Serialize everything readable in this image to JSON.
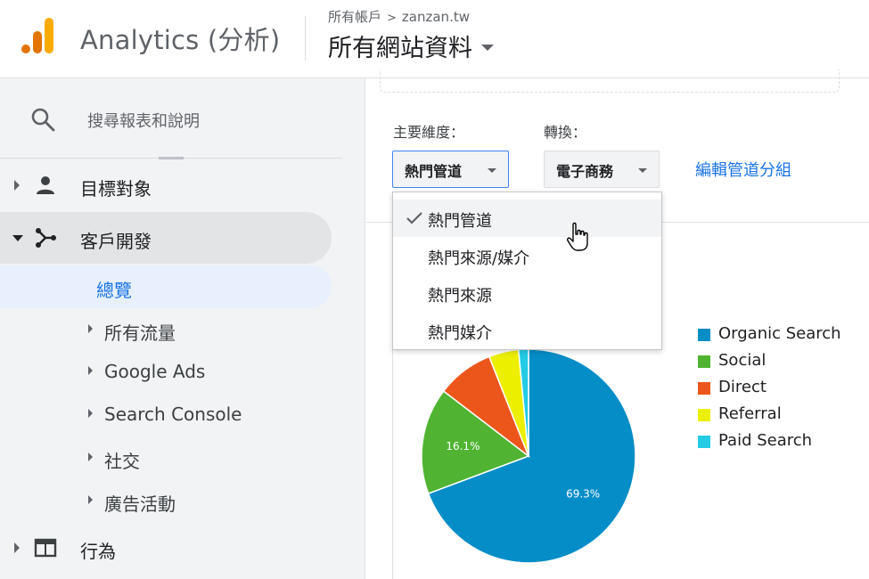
{
  "header": {
    "app_title": "Analytics (分析)",
    "breadcrumb": {
      "account": "所有帳戶",
      "separator": ">",
      "property": "zanzan.tw"
    },
    "view_name": "所有網站資料"
  },
  "sidebar": {
    "search_label": "搜尋報表和說明",
    "items": [
      {
        "label": "目標對象",
        "icon": "person-icon",
        "expanded": false
      },
      {
        "label": "客戶開發",
        "icon": "acquisition-icon",
        "expanded": true
      },
      {
        "label": "行為",
        "icon": "behavior-icon",
        "expanded": false
      }
    ],
    "sub_items": [
      {
        "label": "總覽",
        "selected": true
      },
      {
        "label": "所有流量"
      },
      {
        "label": "Google Ads"
      },
      {
        "label": "Search Console"
      },
      {
        "label": "社交"
      },
      {
        "label": "廣告活動"
      }
    ]
  },
  "main": {
    "primary_dimension_label": "主要維度：",
    "conversion_label": "轉換：",
    "primary_dimension_value": "熱門管道",
    "conversion_value": "電子商務",
    "edit_link": "編輯管道分組",
    "dropdown_options": [
      {
        "label": "熱門管道",
        "checked": true
      },
      {
        "label": "熱門來源/媒介"
      },
      {
        "label": "熱門來源"
      },
      {
        "label": "熱門媒介"
      }
    ]
  },
  "colors": {
    "organic": "#058dc7",
    "social": "#50b432",
    "direct": "#ed561b",
    "referral": "#edef00",
    "paid": "#24cbe5",
    "link": "#1a73e8"
  },
  "chart_data": {
    "type": "pie",
    "title": "",
    "series": [
      {
        "name": "Organic Search",
        "value": 69.3,
        "label": "69.3%"
      },
      {
        "name": "Social",
        "value": 16.1,
        "label": "16.1%"
      },
      {
        "name": "Direct",
        "value": 8.6
      },
      {
        "name": "Referral",
        "value": 4.5
      },
      {
        "name": "Paid Search",
        "value": 1.5
      }
    ],
    "legend_position": "right"
  }
}
